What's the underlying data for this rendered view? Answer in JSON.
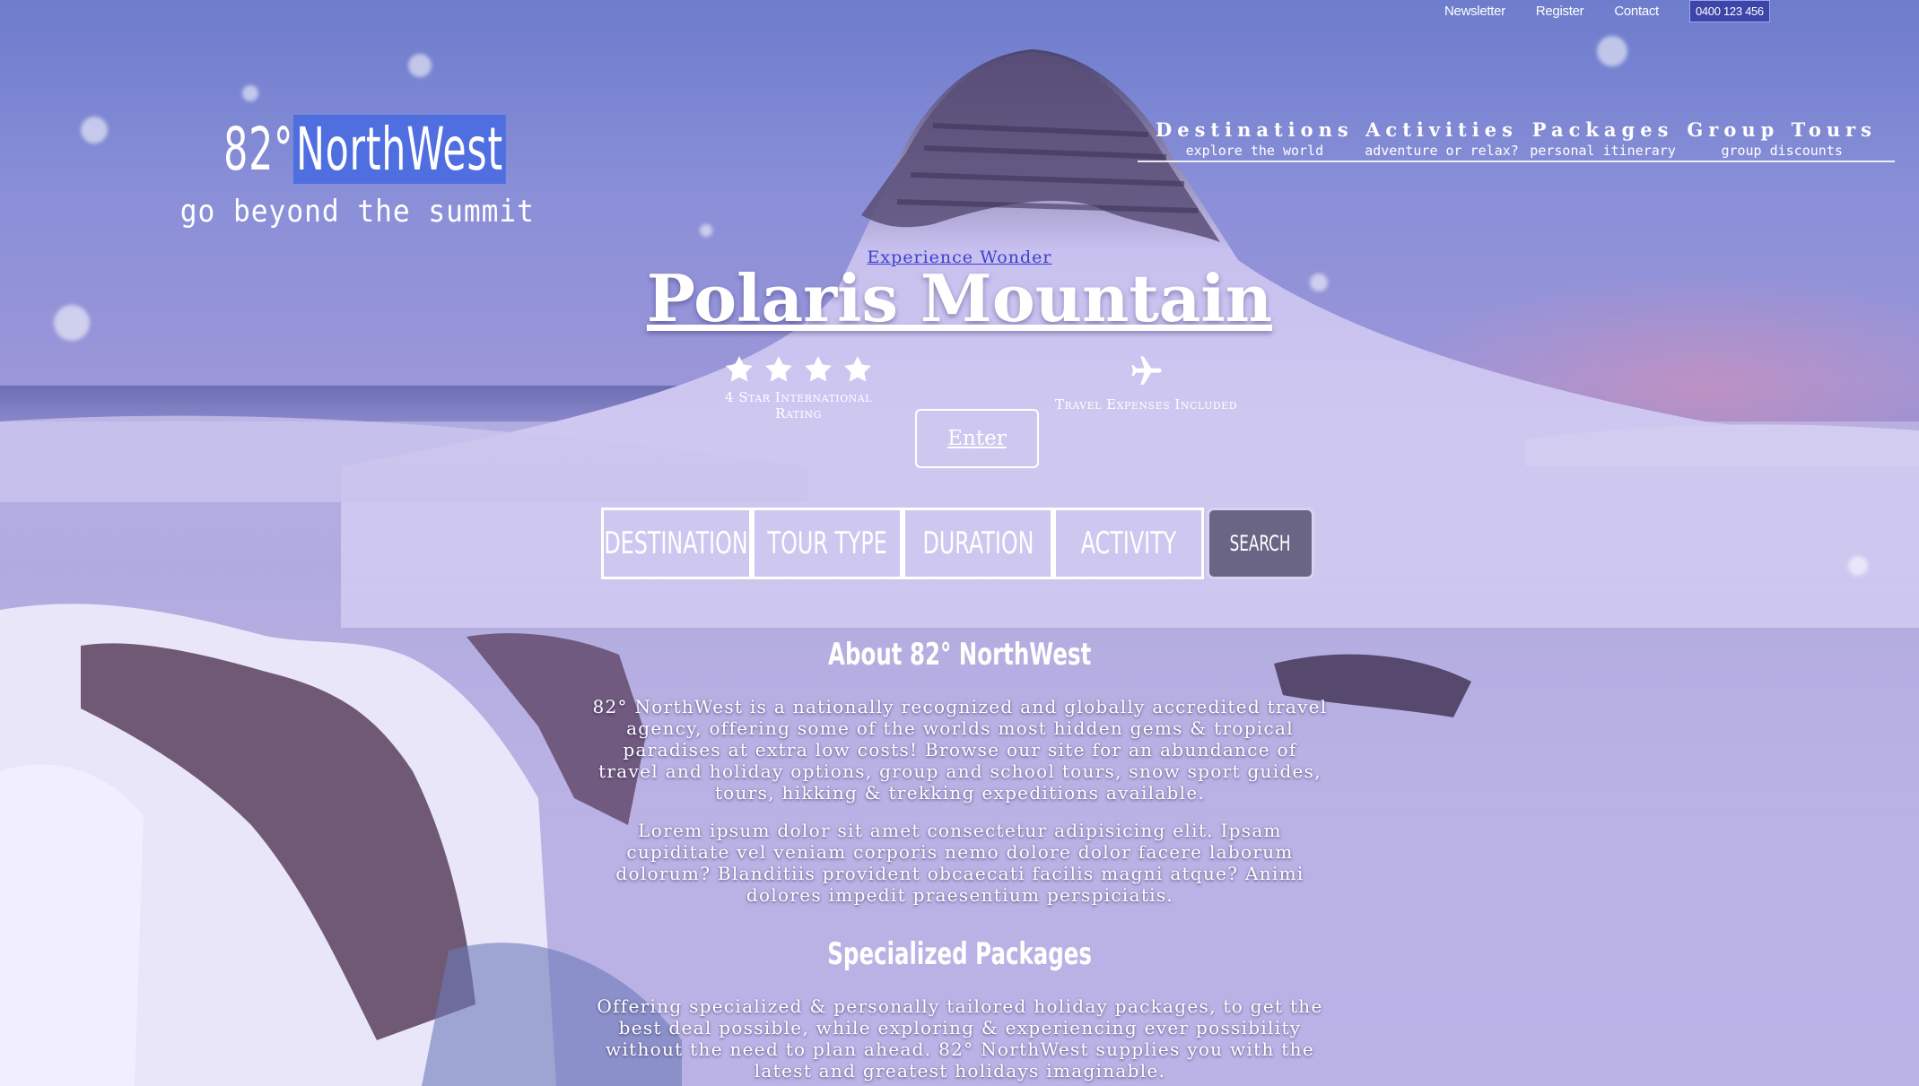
{
  "topbar": {
    "links": [
      "Newsletter",
      "Register",
      "Contact"
    ],
    "phone": "0400 123 456"
  },
  "logo": {
    "prefix": "82°",
    "highlight": "NorthWest",
    "tagline": "go beyond the summit"
  },
  "nav": [
    {
      "title": "Destinations",
      "sub": "explore the world"
    },
    {
      "title": "Activities",
      "sub": "adventure or relax?"
    },
    {
      "title": "Packages",
      "sub": "personal itinerary"
    },
    {
      "title": "Group Tours",
      "sub": "group discounts"
    }
  ],
  "hero": {
    "kicker": "Experience Wonder",
    "title": "Polaris Mountain",
    "rating_caption": "4 Star International Rating",
    "rating_stars": 4,
    "travel_caption": "Travel Expenses Included",
    "enter_label": "Enter"
  },
  "search": {
    "fields": [
      "DESTINATION",
      "TOUR TYPE",
      "DURATION",
      "ACTIVITY"
    ],
    "button": "SEARCH"
  },
  "about": {
    "heading": "About 82° NorthWest",
    "p1": "82° NorthWest is a nationally recognized and globally accredited travel agency, offering some of the worlds most hidden gems & tropical paradises at extra low costs! Browse our site for an abundance of travel and holiday options, group and school tours, snow sport guides, tours, hikking & trekking expeditions available.",
    "p2": "Lorem ipsum dolor sit amet consectetur adipisicing elit. Ipsam cupiditate vel veniam corporis nemo dolore dolor facere laborum dolorum? Blanditiis provident obcaecati facilis magni atque? Animi dolores impedit praesentium perspiciatis."
  },
  "packages": {
    "heading": "Specialized Packages",
    "p1": "Offering specialized & personally tailored holiday packages, to get the best deal possible, while exploring & experiencing ever possibility without the need to plan ahead. 82° NorthWest supplies you with the latest and greatest holidays imaginable."
  }
}
